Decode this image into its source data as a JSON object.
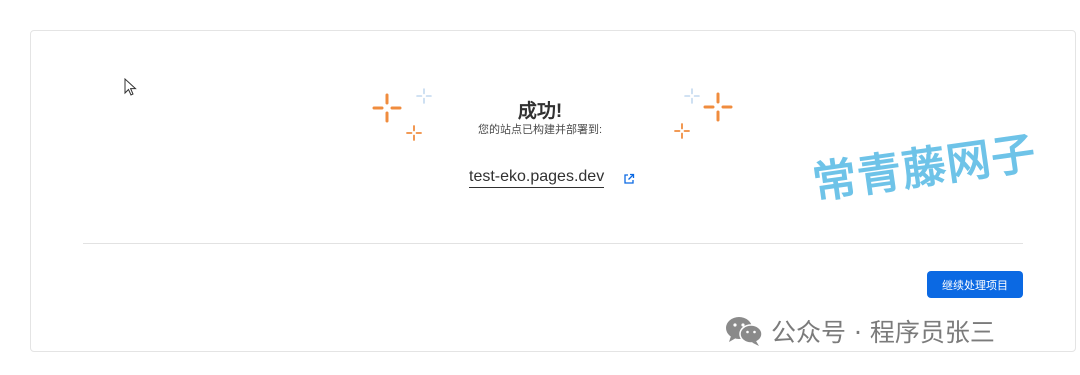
{
  "success": {
    "title": "成功!",
    "subtitle": "您的站点已构建并部署到:",
    "site_link": "test-eko.pages.dev"
  },
  "actions": {
    "continue_label": "继续处理项目"
  },
  "overlay": {
    "watermark_text": "常青藤网子",
    "wechat_caption": "公众号 · 程序员张三"
  },
  "colors": {
    "primary": "#0b69e3",
    "sparkle_orange": "#f08c3e",
    "sparkle_blue": "#c2d8ef",
    "watermark": "#6ec3e8"
  },
  "icons": {
    "cursor": "mouse-pointer-icon",
    "external_link": "external-link-icon",
    "sparkle": "sparkle-icon",
    "wechat": "wechat-icon"
  }
}
